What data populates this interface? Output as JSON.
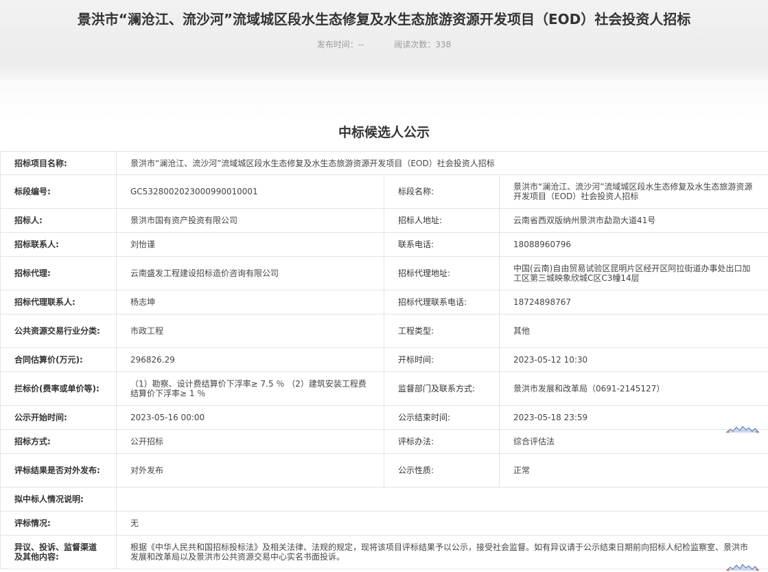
{
  "header": {
    "title": "景洪市“澜沧江、流沙河”流域城区段水生态修复及水生态旅游资源开发项目（EOD）社会投资人招标",
    "publish_time": "发布时间：--",
    "read_count": "阅读次数：338"
  },
  "notice_title": "中标候选人公示",
  "rows": {
    "project_name": {
      "label": "招标项目名称:",
      "value": "景洪市“澜沧江、流沙河”流域城区段水生态修复及水生态旅游资源开发项目（EOD）社会投资人招标"
    },
    "section_no": {
      "label": "标段编号:",
      "value": "GC5328002023000990010001"
    },
    "section_name": {
      "label": "标段名称:",
      "value": "景洪市“澜沧江、流沙河”流域城区段水生态修复及水生态旅游资源开发项目（EOD）社会投资人招标"
    },
    "tenderer": {
      "label": "招标人:",
      "value": "景洪市国有资产投资有限公司"
    },
    "tenderer_addr": {
      "label": "招标人地址:",
      "value": "云南省西双版纳州景洪市勐泐大道41号"
    },
    "contact": {
      "label": "招标联系人:",
      "value": "刘怡谨"
    },
    "phone": {
      "label": "联系电话:",
      "value": "18088960796"
    },
    "agent": {
      "label": "招标代理:",
      "value": "云南盛发工程建设招标造价咨询有限公司"
    },
    "agent_addr": {
      "label": "招标代理地址:",
      "value": "中国(云南)自由贸易试验区昆明片区经开区阿拉街道办事处出口加工区第三城映象欣城C区C3幢14层"
    },
    "agent_contact": {
      "label": "招标代理联系人:",
      "value": "杨志坤"
    },
    "agent_phone": {
      "label": "招标代理联系电话:",
      "value": "18724898767"
    },
    "industry": {
      "label": "公共资源交易行业分类:",
      "value": "市政工程"
    },
    "project_type": {
      "label": "工程类型:",
      "value": "其他"
    },
    "contract_price": {
      "label": "合同估算价(万元):",
      "value": "296826.29"
    },
    "open_time": {
      "label": "开标时间:",
      "value": "2023-05-12 10:30"
    },
    "bid_price": {
      "label": "拦标价(费率或单价等):",
      "value": "（1）勘察、设计费结算价下浮率≥ 7.5 ％ （2）建筑安装工程费结算价下浮率≥ 1 ％"
    },
    "supervisor": {
      "label": "监督部门及联系方式:",
      "value": "景洪市发展和改革局（0691-2145127）"
    },
    "pub_start": {
      "label": "公示开始时间:",
      "value": "2023-05-16 00:00"
    },
    "pub_end": {
      "label": "公示结束时间:",
      "value": "2023-05-18 23:59"
    },
    "method": {
      "label": "招标方式:",
      "value": "公开招标"
    },
    "eval_method": {
      "label": "评标办法:",
      "value": "综合评估法"
    },
    "public_result": {
      "label": "评标结果是否对外发布:",
      "value": "对外发布"
    },
    "pub_nature": {
      "label": "公示性质:",
      "value": "正常"
    },
    "candidate_desc": {
      "label": "拟中标人情况说明:",
      "value": ""
    },
    "eval_status": {
      "label": "评标情况:",
      "value": "无"
    },
    "objection": {
      "label": "异议、投诉、监督渠道及其他内容:",
      "value": "根据《中华人民共和国招标投标法》及相关法律、法规的规定，现将该项目评标结果予以公示，接受社会监督。如有异议请于公示结束日期前向招标人纪检监察室、景洪市发展和改革局以及景洪市公共资源交易中心实名书面投诉。"
    }
  }
}
